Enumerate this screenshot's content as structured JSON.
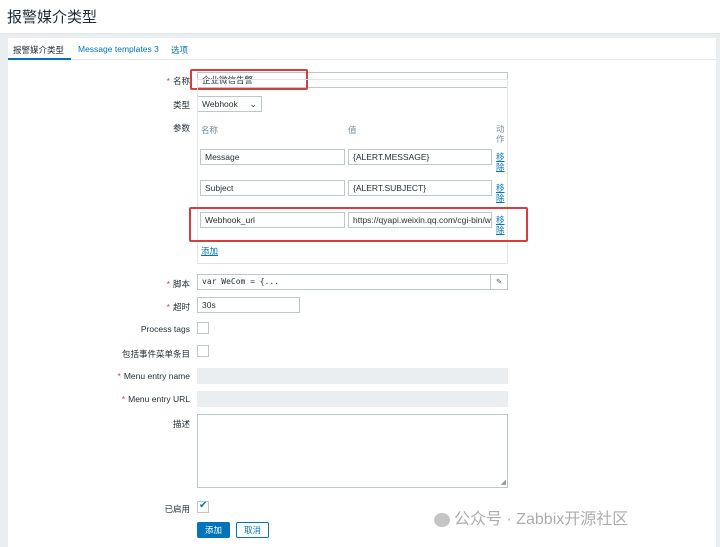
{
  "page_title": "报警媒介类型",
  "tabs": [
    {
      "label": "报警媒介类型"
    },
    {
      "label": "Message templates",
      "count": "3"
    },
    {
      "label": "选项"
    }
  ],
  "form": {
    "name": {
      "label": "名称",
      "value": "企业微信告警"
    },
    "type": {
      "label": "类型",
      "value": "Webhook"
    },
    "params": {
      "label": "参数",
      "col_name": "名称",
      "col_value": "值",
      "col_action": "动作",
      "rows": [
        {
          "name": "Message",
          "value": "{ALERT.MESSAGE}",
          "action": "移除"
        },
        {
          "name": "Subject",
          "value": "{ALERT.SUBJECT}",
          "action": "移除"
        },
        {
          "name": "Webhook_url",
          "value": "https://qyapi.weixin.qq.com/cgi-bin/we",
          "action": "移除"
        }
      ],
      "add": "添加"
    },
    "script": {
      "label": "脚本",
      "value": "var WeCom = {..."
    },
    "timeout": {
      "label": "超时",
      "value": "30s"
    },
    "process_tags": {
      "label": "Process tags"
    },
    "include_menu": {
      "label": "包括事件菜单条目"
    },
    "menu_entry_name": {
      "label": "Menu entry name",
      "value": ""
    },
    "menu_entry_url": {
      "label": "Menu entry URL",
      "value": ""
    },
    "description": {
      "label": "描述",
      "value": ""
    },
    "enabled": {
      "label": "已启用",
      "checked": true
    }
  },
  "buttons": {
    "add": "添加",
    "cancel": "取消"
  },
  "watermark": "公众号 · Zabbix开源社区",
  "colors": {
    "accent": "#0275b8",
    "highlight": "#d63d3d",
    "required": "#e33734"
  }
}
